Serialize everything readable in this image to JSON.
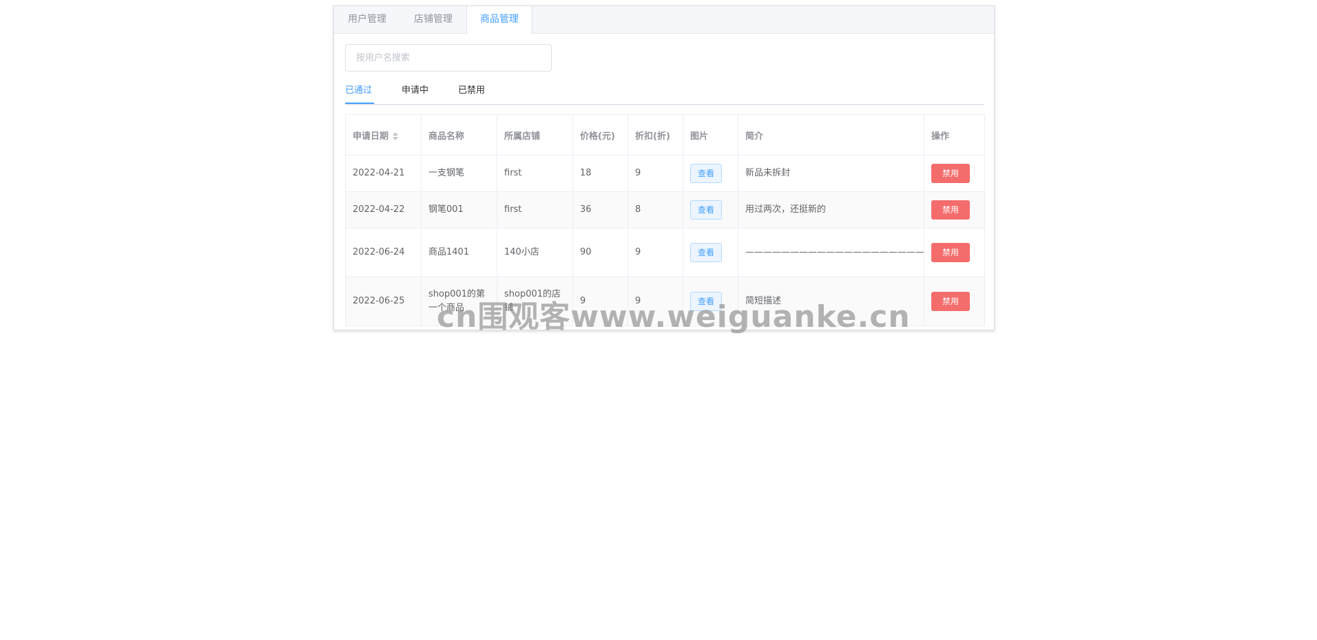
{
  "top_tabs": [
    {
      "label": "用户管理",
      "active": false
    },
    {
      "label": "店铺管理",
      "active": false
    },
    {
      "label": "商品管理",
      "active": true
    }
  ],
  "search": {
    "placeholder": "按用户名搜索",
    "value": ""
  },
  "status_tabs": [
    {
      "label": "已通过",
      "active": true
    },
    {
      "label": "申请中",
      "active": false
    },
    {
      "label": "已禁用",
      "active": false
    }
  ],
  "table": {
    "columns": [
      "申请日期",
      "商品名称",
      "所属店铺",
      "价格(元)",
      "折扣(折)",
      "图片",
      "简介",
      "操作"
    ],
    "view_label": "查看",
    "ban_label": "禁用",
    "rows": [
      {
        "date": "2022-04-21",
        "name": "一支钢笔",
        "shop": "first",
        "price": "18",
        "discount": "9",
        "intro": "新品未拆封"
      },
      {
        "date": "2022-04-22",
        "name": "钢笔001",
        "shop": "first",
        "price": "36",
        "discount": "8",
        "intro": "用过两次，还挺新的"
      },
      {
        "date": "2022-06-24",
        "name": "商品1401",
        "shop": "140小店",
        "price": "90",
        "discount": "9",
        "intro": "——————————————————————————————"
      },
      {
        "date": "2022-06-25",
        "name": "shop001的第一个商品",
        "shop": "shop001的店铺",
        "price": "9",
        "discount": "9",
        "intro": "简短描述"
      }
    ]
  },
  "watermark": "cn围观客www.weiguanke.cn",
  "colors": {
    "primary": "#409eff",
    "danger": "#f56c6c",
    "border": "#ebeef5"
  }
}
